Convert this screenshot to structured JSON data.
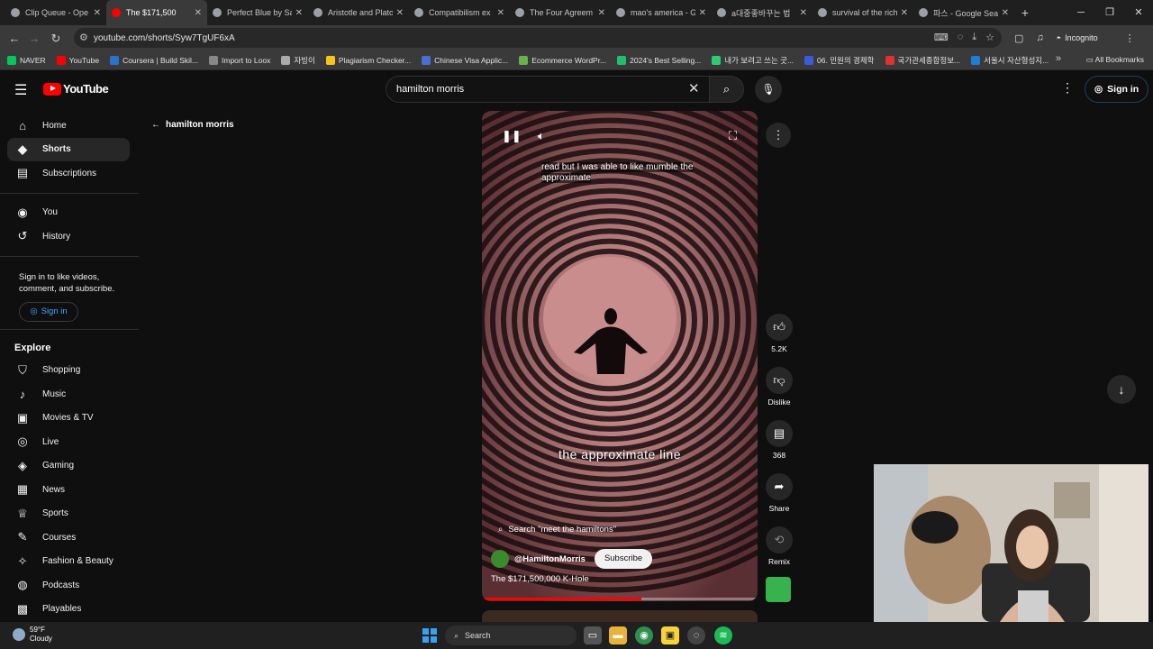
{
  "browser": {
    "tabs": [
      {
        "title": "Clip Queue - Ope",
        "active": false
      },
      {
        "title": "The $171,500",
        "active": true
      },
      {
        "title": "Perfect Blue by Sa",
        "active": false
      },
      {
        "title": "Aristotle and Plato",
        "active": false
      },
      {
        "title": "Compatibilism ex",
        "active": false
      },
      {
        "title": "The Four Agreem",
        "active": false
      },
      {
        "title": "mao's america - G",
        "active": false
      },
      {
        "title": "a대중좋바꾸는 법",
        "active": false
      },
      {
        "title": "survival of the rich",
        "active": false
      },
      {
        "title": "파스 - Google Sea",
        "active": false
      }
    ],
    "url": "youtube.com/shorts/Syw7TgUF6xA",
    "incognito_label": "Incognito",
    "bookmarks": [
      {
        "label": "NAVER",
        "color": "#03c75a"
      },
      {
        "label": "YouTube",
        "color": "#ff0000"
      },
      {
        "label": "Coursera | Build Skil...",
        "color": "#2a73cc"
      },
      {
        "label": "Import to Loox",
        "color": "#888888"
      },
      {
        "label": "자빙이",
        "color": "#aaaaaa"
      },
      {
        "label": "Plagiarism Checker...",
        "color": "#f5c518"
      },
      {
        "label": "Chinese Visa Applic...",
        "color": "#4a6fd4"
      },
      {
        "label": "Ecommerce WordPr...",
        "color": "#6ab04c"
      },
      {
        "label": "2024's Best Selling...",
        "color": "#20bf6b"
      },
      {
        "label": "내가 보려고 쓰는 굿...",
        "color": "#2ecc71"
      },
      {
        "label": "06. 민원의 경제학",
        "color": "#3b5bdb"
      },
      {
        "label": "국가관세종합정보...",
        "color": "#e03131"
      },
      {
        "label": "서울시 자산형성지...",
        "color": "#1c7ed6"
      }
    ],
    "all_bookmarks_label": "All Bookmarks"
  },
  "youtube": {
    "logo_text": "YouTube",
    "search_value": "hamilton morris",
    "signin_label": "Sign in",
    "sidebar": {
      "primary": [
        {
          "label": "Home",
          "icon": "home-icon",
          "glyph": "⌂",
          "active": false
        },
        {
          "label": "Shorts",
          "icon": "shorts-icon",
          "glyph": "◆",
          "active": true
        },
        {
          "label": "Subscriptions",
          "icon": "subscriptions-icon",
          "glyph": "▤",
          "active": false
        }
      ],
      "secondary": [
        {
          "label": "You",
          "icon": "you-icon",
          "glyph": "◉",
          "active": false
        },
        {
          "label": "History",
          "icon": "history-icon",
          "glyph": "↺",
          "active": false
        }
      ],
      "signin_note": "Sign in to like videos, comment, and subscribe.",
      "signin_button": "Sign in",
      "explore_title": "Explore",
      "explore": [
        {
          "label": "Shopping",
          "icon": "shopping-icon",
          "glyph": "⛉"
        },
        {
          "label": "Music",
          "icon": "music-icon",
          "glyph": "♪"
        },
        {
          "label": "Movies & TV",
          "icon": "movies-icon",
          "glyph": "▣"
        },
        {
          "label": "Live",
          "icon": "live-icon",
          "glyph": "◎"
        },
        {
          "label": "Gaming",
          "icon": "gaming-icon",
          "glyph": "◈"
        },
        {
          "label": "News",
          "icon": "news-icon",
          "glyph": "▦"
        },
        {
          "label": "Sports",
          "icon": "sports-icon",
          "glyph": "♕"
        },
        {
          "label": "Courses",
          "icon": "courses-icon",
          "glyph": "✎"
        },
        {
          "label": "Fashion & Beauty",
          "icon": "fashion-icon",
          "glyph": "✧"
        },
        {
          "label": "Podcasts",
          "icon": "podcasts-icon",
          "glyph": "◍"
        },
        {
          "label": "Playables",
          "icon": "playables-icon",
          "glyph": "▩"
        }
      ]
    },
    "back_label": "hamilton morris",
    "short": {
      "caption_top": "read but I was able to like mumble the approximate",
      "caption_main": "the approximate line",
      "search_suggestion": "Search \"meet the hamiltons\"",
      "channel": "@HamiltonMorris",
      "subscribe_label": "Subscribe",
      "title": "The $171,500,000 K-Hole",
      "progress": 0.58
    },
    "actions": {
      "likes": "5.2K",
      "dislike_label": "Dislike",
      "comments": "368",
      "share_label": "Share",
      "remix_label": "Remix"
    }
  },
  "taskbar": {
    "temperature": "59°F",
    "weather": "Cloudy",
    "search_label": "Search"
  },
  "colors": {
    "accent_red": "#ff0000",
    "link_blue": "#3ea6ff",
    "spiral_pink": "#c98d8d"
  }
}
